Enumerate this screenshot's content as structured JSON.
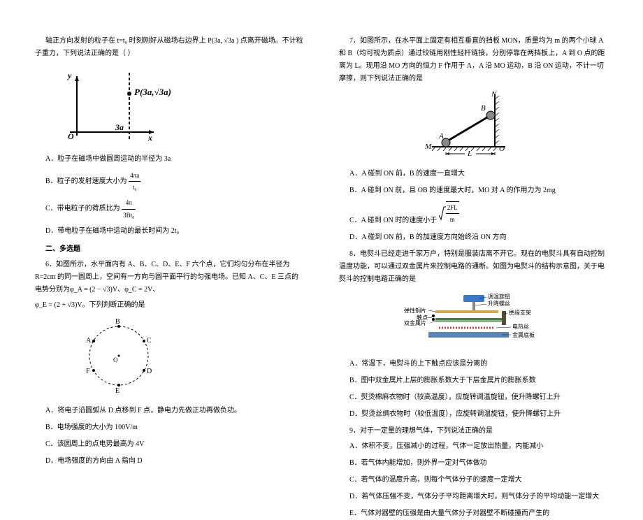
{
  "leftColumn": {
    "q5_intro": "轴正方向发射的粒子在 t=t₀ 时刻刚好从磁场右边界上 P(3a, √3a ) 点离开磁场。不计粒子重力，下列说法正确的是（    ）",
    "q5_fig_label_P": "P(3a,√3a)",
    "q5_fig_label_y": "y",
    "q5_fig_label_O": "O",
    "q5_fig_label_3a": "3a",
    "q5_fig_label_x": "x",
    "q5_A": "A．粒子在磁场中做圆周运动的半径为 3a",
    "q5_B_prefix": "B．粒子的发射速度大小为 ",
    "q5_B_num": "4πa",
    "q5_B_den": "t₀",
    "q5_C_prefix": "C．带电粒子的荷质比为 ",
    "q5_C_num": "4π",
    "q5_C_den": "3Bt₀",
    "q5_D": "D．带电粒子在磁场中运动的最长时间为 2t₀",
    "section2": "二、多选题",
    "q6_intro": "6．如图所示，水平面内有 A、B、C、D、E、F 六个点，它们均匀分布在半径为 R=2cm 的同一圆周上，空间有一方向与圆平面平行的匀强电场。已知 A、C、E 三点的电势分别为φ_A = (2 − √3)V、φ_C = 2V、",
    "q6_intro2": "φ_E = (2 + √3)V。下列判断正确的是",
    "q6_A": "A．将电子沿圆弧从 D 点移到 F 点，静电力先做正功再做负功。",
    "q6_B": "B．电场强度的大小为 100V/m",
    "q6_C": "C．该圆周上的点电势最高为 4V",
    "q6_D": "D．电场强度的方向由 A 指向 D"
  },
  "rightColumn": {
    "q7_intro": "7．如图所示，在水平面上固定有相互垂直的挡板 MON，质量均为 m 的两个小球 A 和 B（均可视为质点）通过铰链用刚性轻杆链接，分别停靠在两挡板上，A 到 O 点的距离为 L。现用沿 MO 方向的恒力 F 作用于 A，A 沿 MO 运动，B 沿 ON 运动，不计一切摩擦，则下列说法正确的是",
    "q7_fig_M": "M",
    "q7_fig_N": "N",
    "q7_fig_A": "A",
    "q7_fig_B": "B",
    "q7_fig_O": "O",
    "q7_fig_L": "L",
    "q7_A": "A．A 碰到 ON 前，B 的速度一直增大",
    "q7_B": "B．A 碰到 ON 前，且 OB 的速度最大时，MO 对 A 的作用力为 2mg",
    "q7_C_prefix": "C．A 碰到 ON 时的速度小于",
    "q7_C_num": "2FL",
    "q7_C_den": "m",
    "q7_D": "D．A 碰到 ON 前，B 的加速度方向始终沿 ON 方向",
    "q8_intro": "8．电熨斗已经走进千家万户，特别是服装店离不开它。现在的电熨斗具有自动控制温度功能，可以通过双金属片来控制电路的通断。如图为电熨斗的结构示意图，关于电熨斗的控制电路正确的是",
    "q8_fig_l1": "弹性铜片",
    "q8_fig_l2": "触点",
    "q8_fig_l3": "双金属片",
    "q8_fig_r1": "调温旋钮",
    "q8_fig_r2": "升降螺丝",
    "q8_fig_r3": "绝缘支架",
    "q8_fig_r4": "电热丝",
    "q8_fig_r5": "金属底板",
    "q8_A": "A．常温下，电熨斗的上下触点应该是分离的",
    "q8_B": "B．图中双金属片上层的膨胀系数大于下层金属片的膨胀系数",
    "q8_C": "C．熨烫棉麻衣物时（较高温度），应旋转调温旋钮，使升降螺钉上升",
    "q8_D": "D．熨烫丝绸衣物时（较低温度），应旋转调温旋钮，使升降螺钉上升",
    "q9_intro": "9．对于一定量的理想气体，下列说法正确的是",
    "q9_A": "A．体积不变，压强减小的过程，气体一定放出热量，内能减小",
    "q9_B": "B．若气体内能增加，则外界一定对气体做功",
    "q9_C": "C．若气体的温度升高，则每个气体分子的速度一定增大",
    "q9_D": "D．若气体压强不变，气体分子平均距离增大时，则气体分子的平均动能一定增大",
    "q9_E": "E．气体对器壁的压强是由大量气体分子对器壁不断碰撞而产生的"
  }
}
